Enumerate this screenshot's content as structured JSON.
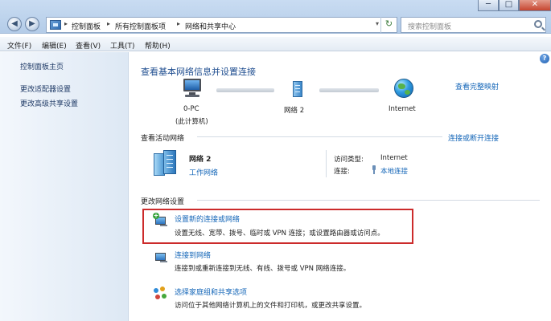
{
  "window": {
    "back_glyph": "◀",
    "forward_glyph": "▶",
    "minimize_glyph": "─",
    "maximize_glyph": "□",
    "close_glyph": "✕",
    "close_color": "#c6452f"
  },
  "address": {
    "crumbs": [
      "控制面板",
      "所有控制面板项",
      "网络和共享中心"
    ],
    "sep": "▸",
    "dropdown": "▾",
    "refresh": "↻"
  },
  "search": {
    "placeholder": "搜索控制面板"
  },
  "menubar": {
    "items": [
      "文件(F)",
      "编辑(E)",
      "查看(V)",
      "工具(T)",
      "帮助(H)"
    ]
  },
  "sidebar": {
    "items": [
      "控制面板主页",
      "更改适配器设置",
      "更改高级共享设置"
    ]
  },
  "main": {
    "help": "?",
    "title": "查看基本网络信息并设置连接",
    "see_full_map": "查看完整映射",
    "map": {
      "pc_name": "0-PC",
      "pc_sub": "(此计算机)",
      "network": "网络  2",
      "internet": "Internet"
    },
    "active_networks": {
      "header": "查看活动网络",
      "connect_disconnect": "连接或断开连接",
      "name": "网络  2",
      "type": "工作网络",
      "access_type_label": "访问类型:",
      "access_type_value": "Internet",
      "connection_label": "连接:",
      "connection_value": "本地连接"
    },
    "change_settings": {
      "header": "更改网络设置",
      "tasks": [
        {
          "title": "设置新的连接或网络",
          "desc": "设置无线、宽带、拨号、临时或 VPN 连接；或设置路由器或访问点。"
        },
        {
          "title": "连接到网络",
          "desc": "连接到或重新连接到无线、有线、拨号或 VPN 网络连接。"
        },
        {
          "title": "选择家庭组和共享选项",
          "desc": "访问位于其他网络计算机上的文件和打印机，或更改共享设置。"
        }
      ]
    },
    "highlight_color": "#cc2b2b"
  }
}
